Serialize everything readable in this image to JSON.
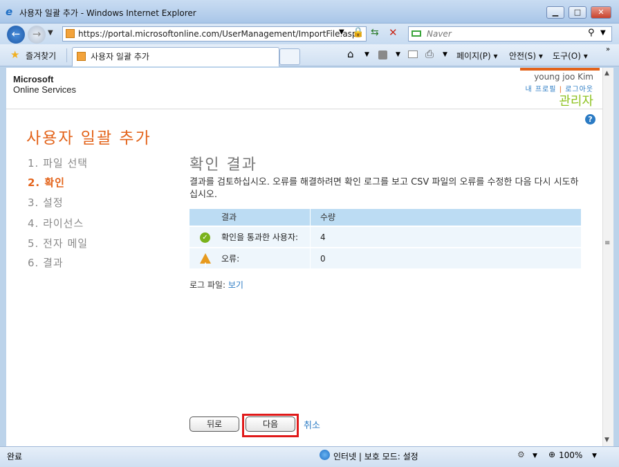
{
  "window": {
    "title": "사용자 일괄 추가 - Windows Internet Explorer",
    "minimize": "▁",
    "maximize": "□",
    "close": "✕"
  },
  "address_bar": {
    "url": "https://portal.microsoftonline.com/UserManagement/ImportFile.aspx",
    "search_placeholder": "Naver"
  },
  "favorites_bar": {
    "favorites_label": "즐겨찾기",
    "tab_title": "사용자 일괄 추가",
    "page_menu": "페이지(P) ▾",
    "safety_menu": "안전(S) ▾",
    "tools_menu": "도구(O) ▾"
  },
  "header": {
    "logo_line1": "Microsoft",
    "logo_line2": "Online Services",
    "user_name": "young joo Kim",
    "profile_link": "내 프로필",
    "separator": "|",
    "logout_link": "로그아웃",
    "role": "관리자"
  },
  "wizard": {
    "title": "사용자 일괄 추가",
    "steps": [
      {
        "label": "1. 파일 선택"
      },
      {
        "label": "2. 확인"
      },
      {
        "label": "3. 설정"
      },
      {
        "label": "4. 라이선스"
      },
      {
        "label": "5. 전자 메일"
      },
      {
        "label": "6. 결과"
      }
    ]
  },
  "content": {
    "section_title": "확인 결과",
    "description": "결과를 검토하십시오. 오류를 해결하려면 확인 로그를 보고 CSV 파일의 오류를 수정한 다음 다시 시도하십시오.",
    "table": {
      "headers": [
        "결과",
        "수량"
      ],
      "rows": [
        {
          "label": "확인을 통과한 사용자:",
          "value": "4"
        },
        {
          "label": "오류:",
          "value": "0"
        }
      ]
    },
    "log_label": "로그 파일:",
    "log_link": "보기"
  },
  "buttons": {
    "back": "뒤로",
    "next": "다음",
    "cancel": "취소"
  },
  "status_bar": {
    "done": "완료",
    "zone": "인터넷 | 보호 모드: 설정",
    "zoom": "100%"
  }
}
